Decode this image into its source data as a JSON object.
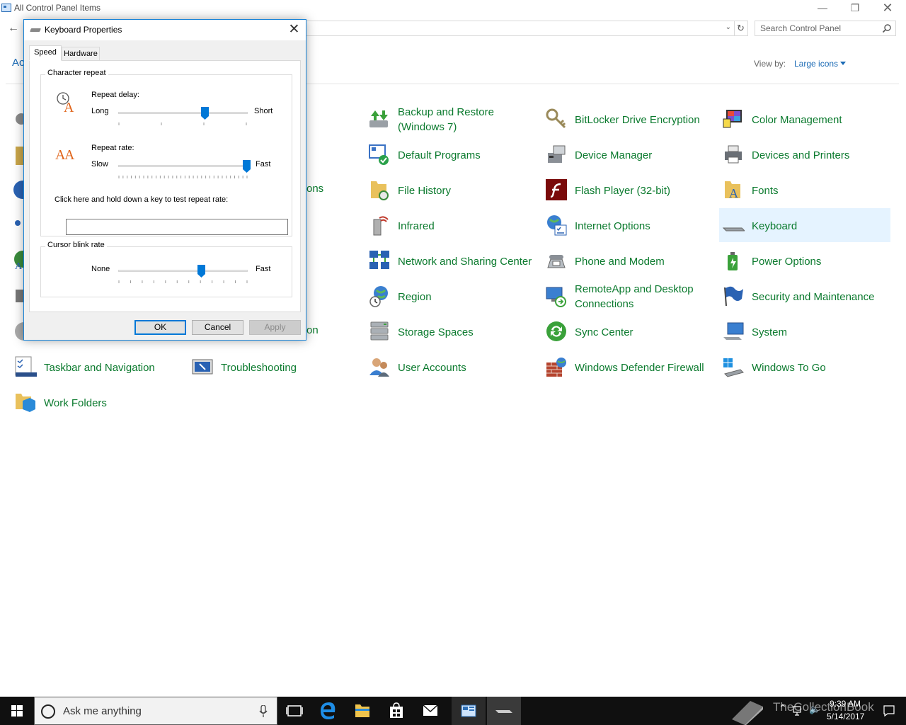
{
  "window": {
    "title": "All Control Panel Items",
    "adjust_text": "Ac",
    "search_placeholder": "Search Control Panel",
    "view_by_label": "View by:",
    "view_by_value": "Large icons"
  },
  "partially_hidden_labels": {
    "row3": "ons",
    "row7": "on"
  },
  "items": {
    "backup": "Backup and Restore (Windows 7)",
    "bitlocker": "BitLocker Drive Encryption",
    "color_mgmt": "Color Management",
    "default_programs": "Default Programs",
    "device_manager": "Device Manager",
    "devices_printers": "Devices and Printers",
    "file_history": "File History",
    "flash_player": "Flash Player (32-bit)",
    "fonts": "Fonts",
    "infrared": "Infrared",
    "internet_options": "Internet Options",
    "keyboard": "Keyboard",
    "network_sharing": "Network and Sharing Center",
    "phone_modem": "Phone and Modem",
    "power_options": "Power Options",
    "region": "Region",
    "remoteapp": "RemoteApp and Desktop Connections",
    "security_maintenance": "Security and Maintenance",
    "storage_spaces": "Storage Spaces",
    "sync_center": "Sync Center",
    "system": "System",
    "taskbar_nav": "Taskbar and Navigation",
    "troubleshooting": "Troubleshooting",
    "user_accounts": "User Accounts",
    "windows_defender": "Windows Defender Firewall",
    "windows_to_go": "Windows To Go",
    "work_folders": "Work Folders"
  },
  "dialog": {
    "title": "Keyboard Properties",
    "tabs": [
      "Speed",
      "Hardware"
    ],
    "char_repeat_group": "Character repeat",
    "repeat_delay_label": "Repeat delay:",
    "repeat_delay_min": "Long",
    "repeat_delay_max": "Short",
    "repeat_delay_fraction": 0.67,
    "repeat_rate_label": "Repeat rate:",
    "repeat_rate_min": "Slow",
    "repeat_rate_max": "Fast",
    "repeat_rate_fraction": 1.0,
    "test_label": "Click here and hold down a key to test repeat rate:",
    "test_value": "",
    "cursor_group": "Cursor blink rate",
    "blink_min": "None",
    "blink_max": "Fast",
    "blink_fraction": 0.64,
    "ok": "OK",
    "cancel": "Cancel",
    "apply": "Apply"
  },
  "taskbar": {
    "search_placeholder": "Ask me anything",
    "time": "9:39 AM",
    "date": "5/14/2017",
    "watermark": "TheCollectionBook"
  },
  "colors": {
    "link_green": "#0b7a2e",
    "accent_blue": "#0078d7",
    "selected_bg": "#e5f3ff",
    "taskbar": "#101010"
  }
}
